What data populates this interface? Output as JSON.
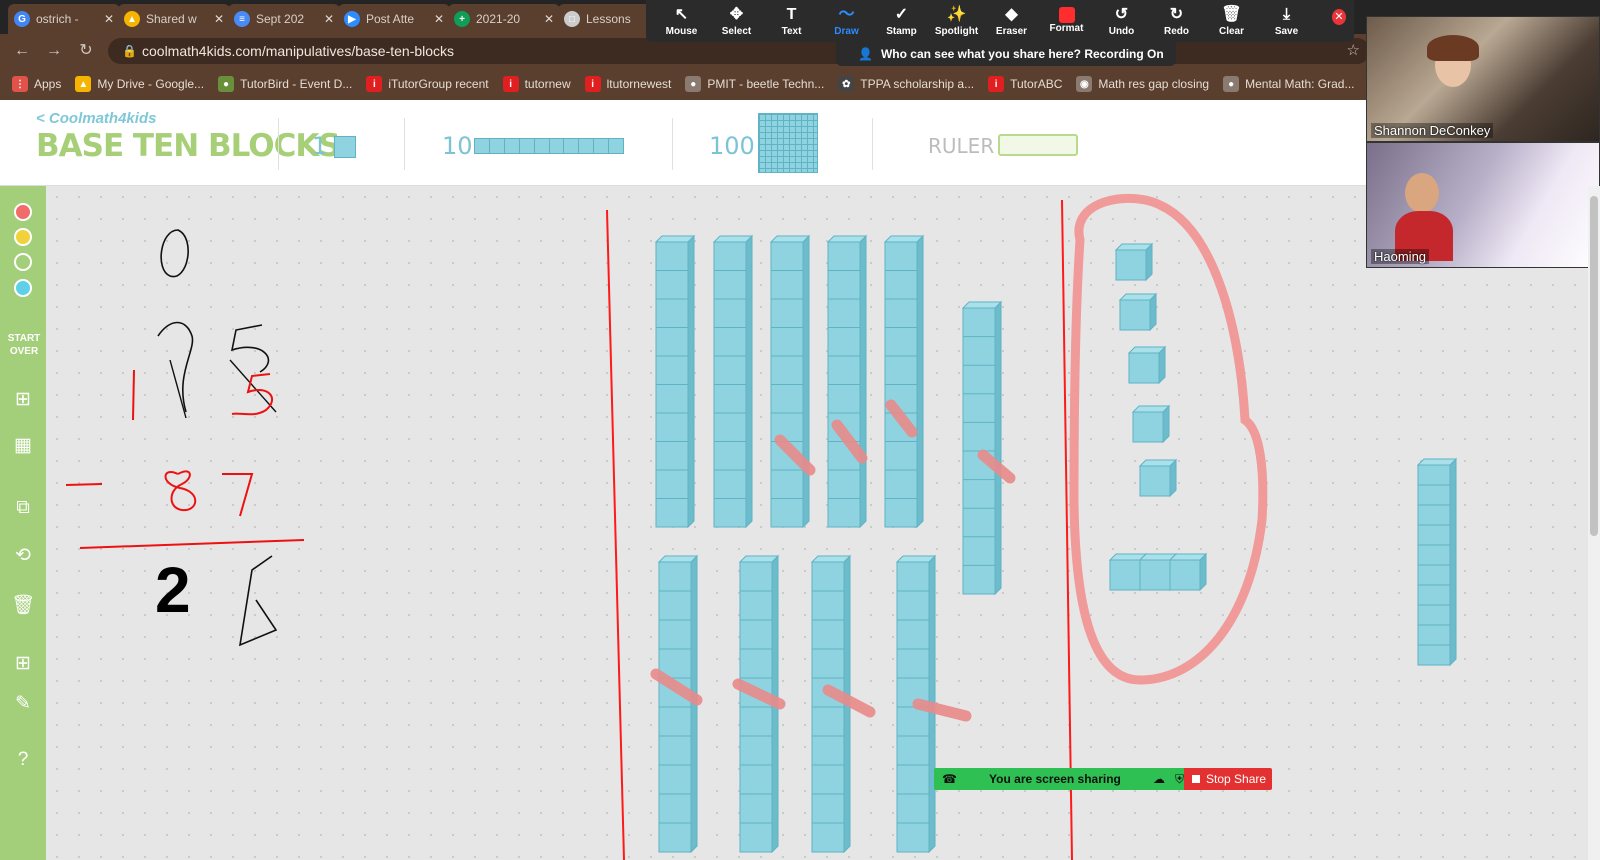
{
  "tabs": [
    {
      "title": "ostrich -",
      "icon": "google-icon",
      "color": "#4285f4",
      "glyph": "G"
    },
    {
      "title": "Shared w",
      "icon": "drive-icon",
      "color": "#f4b400",
      "glyph": "▲"
    },
    {
      "title": "Sept 202",
      "icon": "docs-icon",
      "color": "#4a8af4",
      "glyph": "≡"
    },
    {
      "title": "Post Atte",
      "icon": "zoom-icon",
      "color": "#2d8cff",
      "glyph": "▶"
    },
    {
      "title": "2021-20",
      "icon": "sheets-icon",
      "color": "#0f9d58",
      "glyph": "+"
    },
    {
      "title": "Lessons",
      "icon": "lessons-icon",
      "color": "#cccccc",
      "glyph": "□"
    }
  ],
  "annotation_toolbar": {
    "tools": [
      {
        "label": "Mouse",
        "icon": "cursor-icon",
        "glyph": "↖",
        "active": false
      },
      {
        "label": "Select",
        "icon": "move-icon",
        "glyph": "✥",
        "active": false
      },
      {
        "label": "Text",
        "icon": "text-icon",
        "glyph": "T",
        "active": false
      },
      {
        "label": "Draw",
        "icon": "draw-icon",
        "glyph": "〜",
        "active": true
      },
      {
        "label": "Stamp",
        "icon": "stamp-icon",
        "glyph": "✓",
        "active": false
      },
      {
        "label": "Spotlight",
        "icon": "spotlight-icon",
        "glyph": "✨",
        "active": false
      },
      {
        "label": "Eraser",
        "icon": "eraser-icon",
        "glyph": "◆",
        "active": false
      },
      {
        "label": "Format",
        "icon": "format-icon",
        "glyph": "",
        "active": false
      },
      {
        "label": "Undo",
        "icon": "undo-icon",
        "glyph": "↺",
        "active": false
      },
      {
        "label": "Redo",
        "icon": "redo-icon",
        "glyph": "↻",
        "active": false
      },
      {
        "label": "Clear",
        "icon": "trash-icon",
        "glyph": "🗑",
        "active": false
      },
      {
        "label": "Save",
        "icon": "save-icon",
        "glyph": "⤓",
        "active": false
      }
    ],
    "close_glyph": "✕"
  },
  "address_bar": {
    "url": "coolmath4kids.com/manipulatives/base-ten-blocks",
    "recording_banner": "Who can see what you share here? Recording On"
  },
  "bookmarks": [
    {
      "label": "Apps",
      "color": "#e0524a",
      "glyph": "⋮"
    },
    {
      "label": "My Drive - Google...",
      "color": "#f4b400",
      "glyph": "▲"
    },
    {
      "label": "TutorBird - Event D...",
      "color": "#6a8f3a",
      "glyph": "●"
    },
    {
      "label": "iTutorGroup recent",
      "color": "#e02020",
      "glyph": "i"
    },
    {
      "label": "tutornew",
      "color": "#e02020",
      "glyph": "i"
    },
    {
      "label": "ltutornewest",
      "color": "#e02020",
      "glyph": "i"
    },
    {
      "label": "PMIT - beetle Techn...",
      "color": "#8a7a70",
      "glyph": "●"
    },
    {
      "label": "TPPA scholarship a...",
      "color": "#444444",
      "glyph": "✿"
    },
    {
      "label": "TutorABC",
      "color": "#e02020",
      "glyph": "i"
    },
    {
      "label": "Math res gap closing",
      "color": "#8a7a70",
      "glyph": "◉"
    },
    {
      "label": "Mental Math: Grad...",
      "color": "#8a7a70",
      "glyph": "●"
    }
  ],
  "header": {
    "back_link": "< Coolmath4kids",
    "title": "BASE TEN BLOCKS",
    "one_label": "1",
    "ten_label": "10",
    "hundred_label": "100",
    "ruler_label": "RULER"
  },
  "sidebar": {
    "colors": [
      "#f26b6b",
      "#f2d23a",
      "#a3cf7b",
      "#5fd0e8"
    ],
    "start_over": "START OVER"
  },
  "workspace": {
    "answer_tens_digit": "2"
  },
  "participants": [
    {
      "name": "Shannon DeConkey"
    },
    {
      "name": "Haoming"
    }
  ],
  "screen_share": {
    "status": "You are screen sharing",
    "stop_label": "Stop Share"
  }
}
